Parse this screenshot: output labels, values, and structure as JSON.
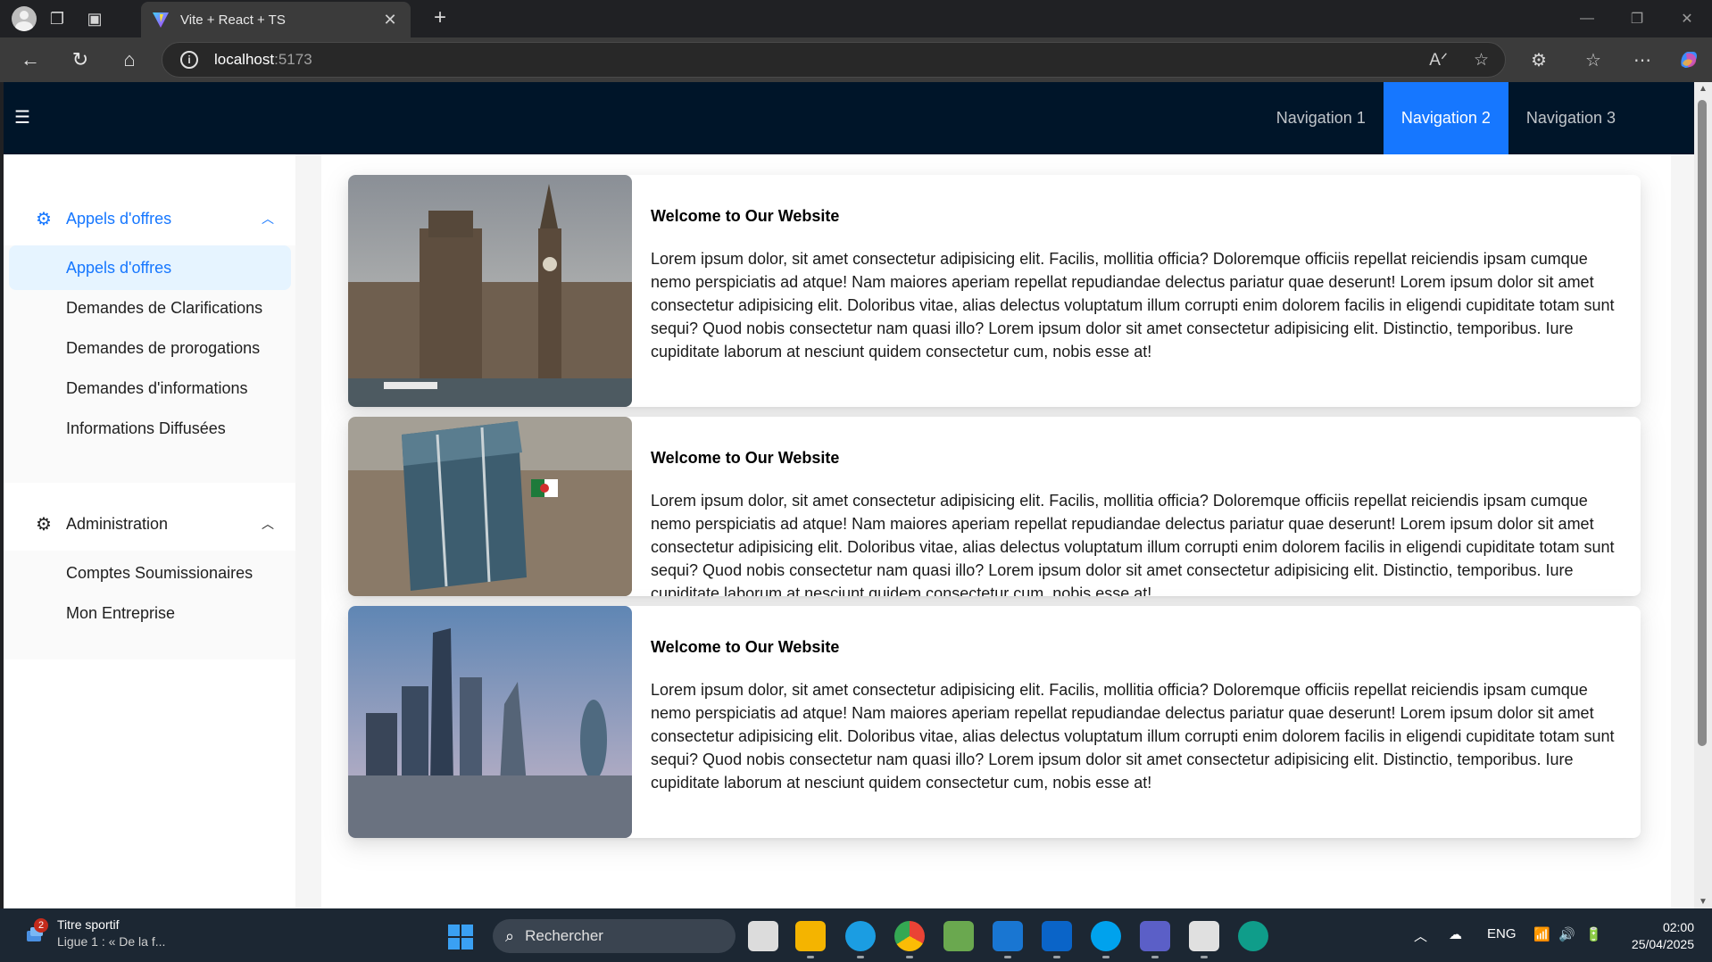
{
  "browser": {
    "tab_title": "Vite + React + TS",
    "url_host": "localhost",
    "url_port": ":5173"
  },
  "app": {
    "top_nav": [
      {
        "label": "Navigation 1",
        "active": false
      },
      {
        "label": "Navigation 2",
        "active": true
      },
      {
        "label": "Navigation 3",
        "active": false
      }
    ],
    "sidebar": {
      "groups": [
        {
          "title": "Appels d'offres",
          "open": true,
          "items": [
            {
              "label": "Appels d'offres",
              "selected": true
            },
            {
              "label": "Demandes de Clarifications",
              "selected": false
            },
            {
              "label": "Demandes de prorogations",
              "selected": false
            },
            {
              "label": "Demandes d'informations",
              "selected": false
            },
            {
              "label": "Informations Diffusées",
              "selected": false
            }
          ]
        },
        {
          "title": "Administration",
          "open": false,
          "items": [
            {
              "label": "Comptes Soumissionaires",
              "selected": false
            },
            {
              "label": "Mon Entreprise",
              "selected": false
            }
          ]
        }
      ]
    },
    "cards": [
      {
        "title": "Welcome to Our Website",
        "text": "Lorem ipsum dolor, sit amet consectetur adipisicing elit. Facilis, mollitia officia? Doloremque officiis repellat reiciendis ipsam cumque nemo perspiciatis ad atque! Nam maiores aperiam repellat repudiandae delectus pariatur quae deserunt! Lorem ipsum dolor sit amet consectetur adipisicing elit. Doloribus vitae, alias delectus voluptatum illum corrupti enim dolorem facilis in eligendi cupiditate totam sunt sequi? Quod nobis consectetur nam quasi illo? Lorem ipsum dolor sit amet consectetur adipisicing elit. Distinctio, temporibus. Iure cupiditate laborum at nesciunt quidem consectetur cum, nobis esse at!",
        "image": "westminster-big-ben-photo"
      },
      {
        "title": "Welcome to Our Website",
        "text": "Lorem ipsum dolor, sit amet consectetur adipisicing elit. Facilis, mollitia officia? Doloremque officiis repellat reiciendis ipsam cumque nemo perspiciatis ad atque! Nam maiores aperiam repellat repudiandae delectus pariatur quae deserunt! Lorem ipsum dolor sit amet consectetur adipisicing elit. Doloribus vitae, alias delectus voluptatum illum corrupti enim dolorem facilis in eligendi cupiditate totam sunt sequi? Quod nobis consectetur nam quasi illo? Lorem ipsum dolor sit amet consectetur adipisicing elit. Distinctio, temporibus. Iure cupiditate laborum at nesciunt quidem consectetur cum, nobis esse at!",
        "image": "glass-tower-with-flag-photo"
      },
      {
        "title": "Welcome to Our Website",
        "text": "Lorem ipsum dolor, sit amet consectetur adipisicing elit. Facilis, mollitia officia? Doloremque officiis repellat reiciendis ipsam cumque nemo perspiciatis ad atque! Nam maiores aperiam repellat repudiandae delectus pariatur quae deserunt! Lorem ipsum dolor sit amet consectetur adipisicing elit. Doloribus vitae, alias delectus voluptatum illum corrupti enim dolorem facilis in eligendi cupiditate totam sunt sequi? Quod nobis consectetur nam quasi illo? Lorem ipsum dolor sit amet consectetur adipisicing elit. Distinctio, temporibus. Iure cupiditate laborum at nesciunt quidem consectetur cum, nobis esse at!",
        "image": "city-skyline-photo"
      }
    ]
  },
  "taskbar": {
    "widget_title": "Titre sportif",
    "widget_subtitle": "Ligue 1 : « De la f...",
    "widget_badge": "2",
    "search_placeholder": "Rechercher",
    "language": "ENG",
    "time": "02:00",
    "date": "25/04/2025"
  },
  "colors": {
    "header_bg": "#001529",
    "accent": "#1677ff",
    "selected_bg": "#e6f4ff"
  }
}
